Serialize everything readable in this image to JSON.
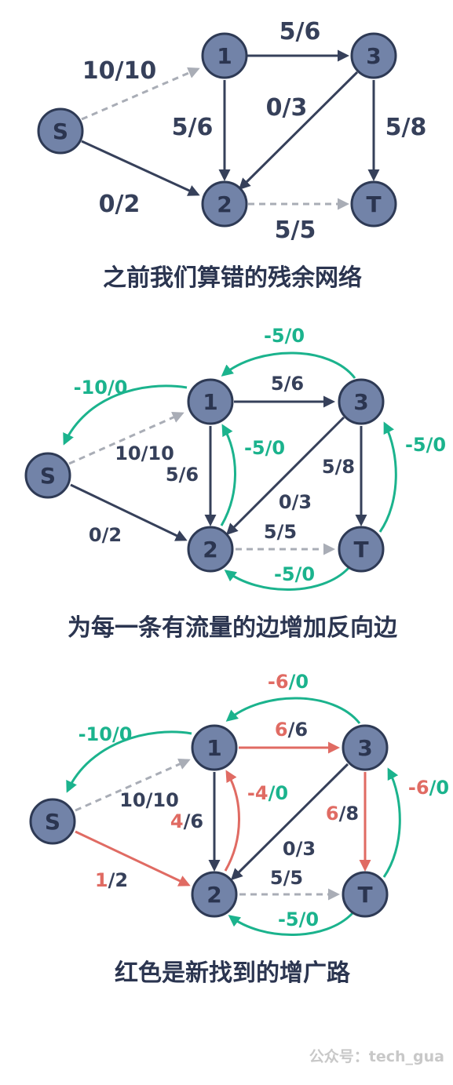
{
  "colors": {
    "dark": "#36405a",
    "gray": "#a9adb6",
    "green": "#1bb38d",
    "red": "#e06b63",
    "node_fill": "#7283a8"
  },
  "diagram1": {
    "caption": "之前我们算错的残余网络",
    "nodes": {
      "S": "S",
      "n1": "1",
      "n2": "2",
      "n3": "3",
      "T": "T"
    },
    "edges": {
      "s1": "10/10",
      "s2": "0/2",
      "e12": "5/6",
      "e13": "5/6",
      "e32": "0/3",
      "e3t": "5/8",
      "e2t": "5/5"
    }
  },
  "diagram2": {
    "caption": "为每一条有流量的边增加反向边",
    "nodes": {
      "S": "S",
      "n1": "1",
      "n2": "2",
      "n3": "3",
      "T": "T"
    },
    "edges": {
      "s1": "10/10",
      "s2": "0/2",
      "e12": "5/6",
      "e13": "5/6",
      "e32": "0/3",
      "e3t": "5/8",
      "e2t": "5/5",
      "r1s": "-10/0",
      "r31": "-5/0",
      "r21": "-5/0",
      "rt3": "-5/0",
      "rt2": "-5/0"
    }
  },
  "diagram3": {
    "caption": "红色是新找到的增广路",
    "nodes": {
      "S": "S",
      "n1": "1",
      "n2": "2",
      "n3": "3",
      "T": "T"
    },
    "edges": {
      "s1": "10/10",
      "s2_flow": "1",
      "s2_cap": "/2",
      "e12_flow": "4",
      "e12_cap": "/6",
      "e13_flow": "6",
      "e13_cap": "/6",
      "e32": "0/3",
      "e3t_flow": "6",
      "e3t_cap": "/8",
      "e2t": "5/5",
      "r1s": "-10/0",
      "r31_flow": "-6",
      "r31_cap": "/0",
      "r21_flow": "-4",
      "r21_cap": "/0",
      "rt3_flow": "-6",
      "rt3_cap": "/0",
      "rt2": "-5/0"
    }
  },
  "watermark": "公众号：tech_gua"
}
